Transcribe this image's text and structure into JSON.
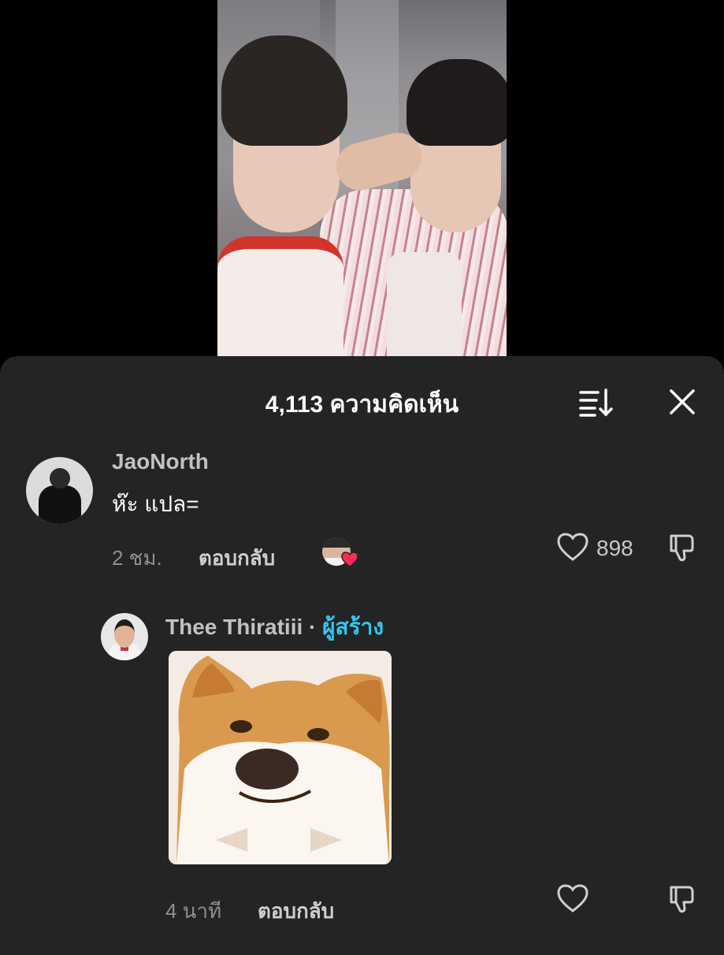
{
  "header": {
    "title": "4,113 ความคิดเห็น",
    "sort_icon": "sort-icon",
    "close_icon": "close-icon"
  },
  "comments": [
    {
      "username": "JaoNorth",
      "text": "ห๊ะ แปล=",
      "time": "2 ชม.",
      "reply_label": "ตอบกลับ",
      "like_count": "898",
      "liked_by_creator": true
    }
  ],
  "reply": {
    "username": "Thee Thiratiii",
    "separator": " · ",
    "creator_badge": "ผู้สร้าง",
    "content": "shiba-dog-sticker",
    "time": "4 นาที",
    "reply_label": "ตอบกลับ"
  },
  "colors": {
    "sheet_bg": "#242424",
    "creator_badge": "#31c7f0",
    "like_heart": "#fe2c55"
  }
}
